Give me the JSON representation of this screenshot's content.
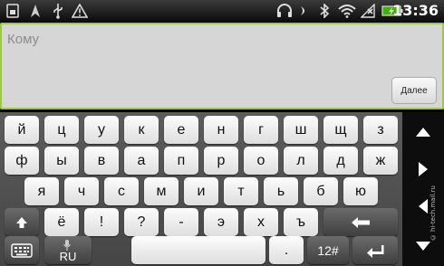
{
  "status_bar": {
    "time": "13:36",
    "left_icons": [
      "sim-icon",
      "navigation-arrow-icon",
      "usb-icon",
      "warning-icon"
    ],
    "right_icons": [
      "headphones-icon",
      "mute-icon",
      "bluetooth-icon",
      "wifi-icon",
      "signal-off-icon",
      "battery-charging-icon"
    ]
  },
  "compose": {
    "to_placeholder": "Кому",
    "next_label": "Далее",
    "accent_color": "#9acd32"
  },
  "keyboard": {
    "row1": [
      "й",
      "ц",
      "у",
      "к",
      "е",
      "н",
      "г",
      "ш",
      "щ",
      "з"
    ],
    "row2": [
      "ф",
      "ы",
      "в",
      "а",
      "п",
      "р",
      "о",
      "л",
      "д",
      "ж"
    ],
    "row3": [
      "я",
      "ч",
      "с",
      "м",
      "и",
      "т",
      "ь",
      "б",
      "ю"
    ],
    "row4": [
      "ё",
      "!",
      "?",
      "-",
      "э",
      "х",
      "ъ"
    ],
    "language_label": "RU",
    "symbols_label": "12#",
    "period_label": "."
  },
  "side_panel": {
    "buttons": [
      "up-arrow-icon",
      "right-arrow-icon",
      "left-arrow-icon",
      "down-arrow-icon"
    ]
  },
  "watermark": "© hi-tech.mail.ru"
}
